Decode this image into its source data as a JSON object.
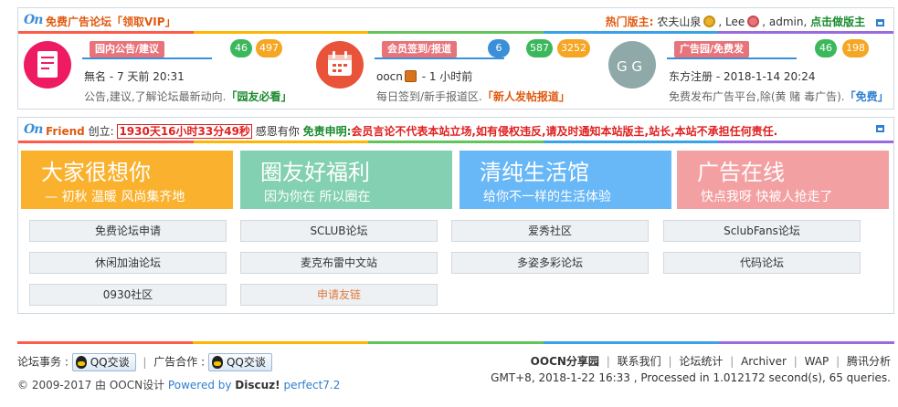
{
  "colors": {
    "rainbow": [
      "#ff5a4a",
      "#ffb600",
      "#62c55b",
      "#3aa3e8",
      "#9a6be0"
    ],
    "green_badge": "#3cb85c",
    "orange_badge": "#f5a623",
    "blue_badge": "#3a8fd8"
  },
  "top_bar": {
    "logo": "On",
    "title": "免费广告论坛",
    "vip": "「领取VIP」",
    "hot_label": "热门版主:",
    "mods": [
      "农夫山泉",
      "Lee",
      "admin"
    ],
    "sep": ",",
    "be_mod": "点击做版主"
  },
  "forums": [
    {
      "tag": "园内公告/建议",
      "counts": [
        "46",
        "497"
      ],
      "author": "無名",
      "time": " - 7 天前 20:31",
      "desc": "公告,建议,了解论坛最新动向.",
      "link": "「园友必看」"
    },
    {
      "tag": "会员签到/报道",
      "counts": [
        "6",
        "587",
        "3252"
      ],
      "author": "oocn",
      "time": " - 1 小时前",
      "desc": "每日签到/新手报道区.",
      "link": "「新人发帖报道」"
    },
    {
      "tag": "广告园/免费发",
      "counts": [
        "46",
        "198"
      ],
      "author": "东方注册",
      "time": " - 2018-1-14 20:24",
      "desc": "免费发布广告平台,除(黄 赌 毒广告).",
      "link": "「免费」"
    }
  ],
  "friend_bar": {
    "logo": "On",
    "friend": "Friend",
    "created": "创立:",
    "timer": "1930天16小时33分49秒",
    "thanks": "感恩有你",
    "notice_label": "免责申明:",
    "notice_text": "会员言论不代表本站立场,如有侵权违反,请及时通知本站版主,站长,本站不承担任何责任."
  },
  "banners": [
    {
      "title": "大家很想你",
      "sub": "— 初秋 温暖 风尚集齐地",
      "color": "#fab22e"
    },
    {
      "title": "圈友好福利",
      "sub": "因为你在 所以圈在",
      "color": "#83d0b2"
    },
    {
      "title": "清纯生活馆",
      "sub": "给你不一样的生活体验",
      "color": "#68b7f6"
    },
    {
      "title": "广告在线",
      "sub": "快点我呀 快被人抢走了",
      "color": "#f3a0a2"
    }
  ],
  "links": [
    "免费论坛申请",
    "SCLUB论坛",
    "爱秀社区",
    "SclubFans论坛",
    "休闲加油论坛",
    "麦克布雷中文站",
    "多姿多彩论坛",
    "代码论坛",
    "0930社区",
    "申请友链"
  ],
  "footer": {
    "affairs": "论坛事务 :",
    "qq": "QQ交谈",
    "ad_coop": "广告合作 :",
    "copyright": "© 2009-2017 由 OOCN设计 ",
    "powered": "Powered by ",
    "discuz": "Discuz!",
    "version": " perfect7.2",
    "nav": [
      "OOCN分享园",
      "联系我们",
      "论坛统计",
      "Archiver",
      "WAP",
      "腾讯分析"
    ],
    "nav_sep": "|",
    "stats": "GMT+8, 2018-1-22 16:33 , Processed in 1.012172 second(s), 65 queries."
  }
}
